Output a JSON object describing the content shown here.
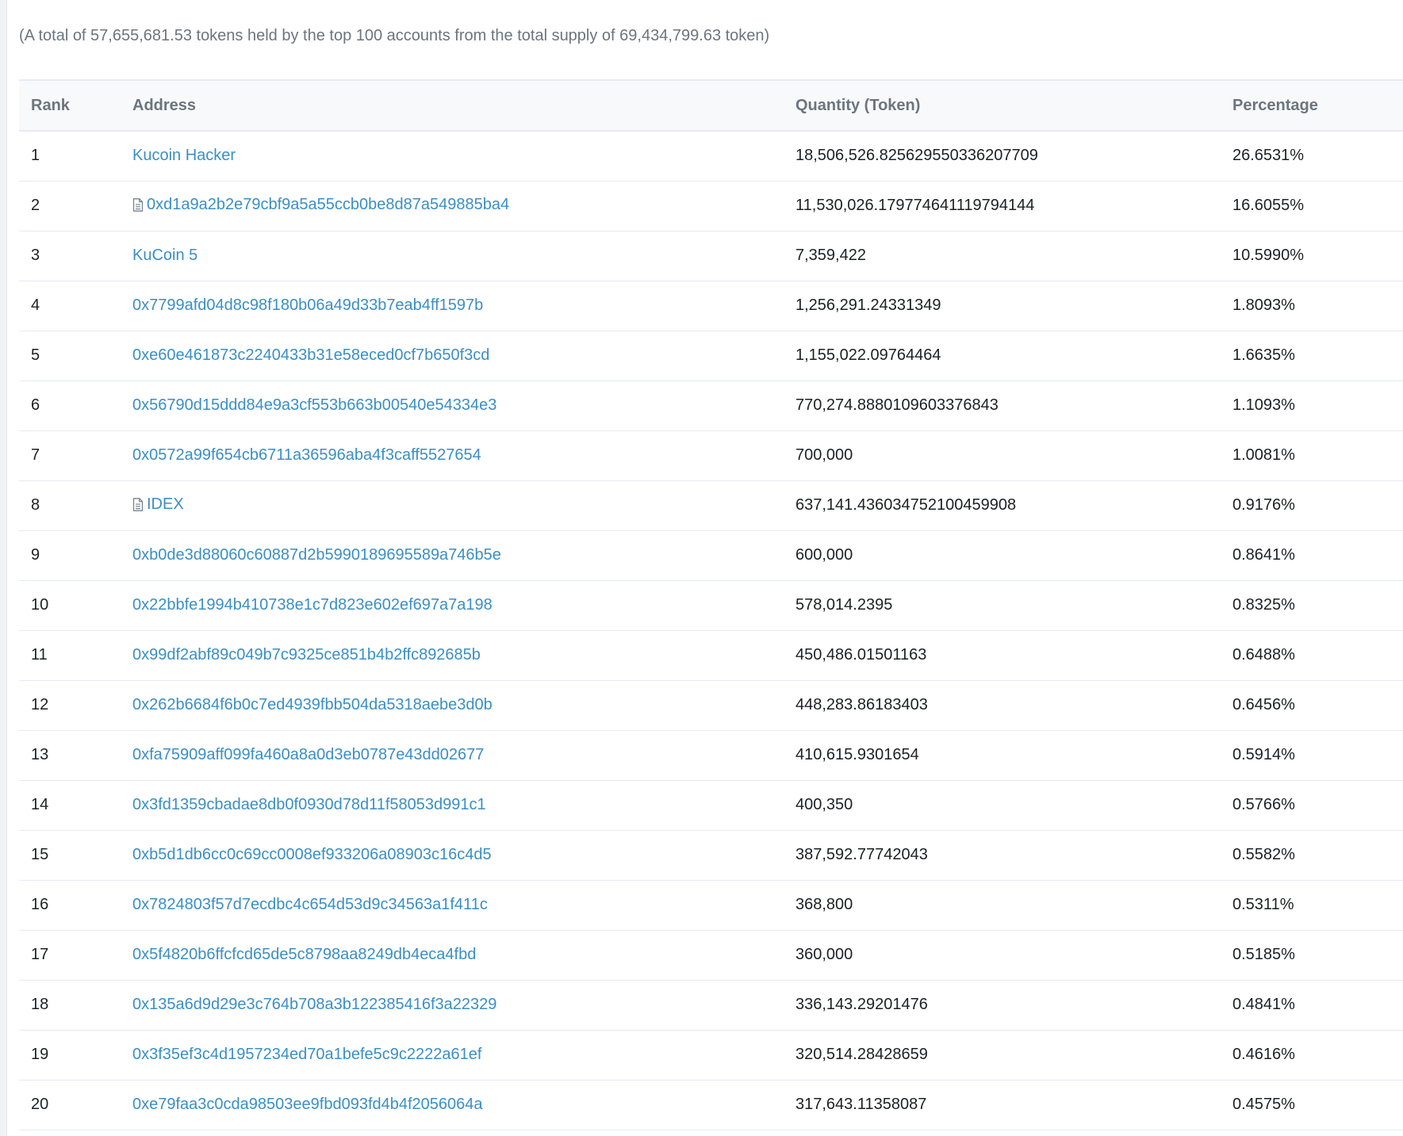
{
  "summary": "(A total of 57,655,681.53 tokens held by the top 100 accounts from the total supply of 69,434,799.63 token)",
  "table": {
    "headers": {
      "rank": "Rank",
      "address": "Address",
      "quantity": "Quantity (Token)",
      "percentage": "Percentage"
    },
    "rows": [
      {
        "rank": "1",
        "address": "Kucoin Hacker",
        "contract_icon": false,
        "quantity": "18,506,526.825629550336207709",
        "percentage": "26.6531%"
      },
      {
        "rank": "2",
        "address": "0xd1a9a2b2e79cbf9a5a55ccb0be8d87a549885ba4",
        "contract_icon": true,
        "quantity": "11,530,026.179774641119794144",
        "percentage": "16.6055%"
      },
      {
        "rank": "3",
        "address": "KuCoin 5",
        "contract_icon": false,
        "quantity": "7,359,422",
        "percentage": "10.5990%"
      },
      {
        "rank": "4",
        "address": "0x7799afd04d8c98f180b06a49d33b7eab4ff1597b",
        "contract_icon": false,
        "quantity": "1,256,291.24331349",
        "percentage": "1.8093%"
      },
      {
        "rank": "5",
        "address": "0xe60e461873c2240433b31e58eced0cf7b650f3cd",
        "contract_icon": false,
        "quantity": "1,155,022.09764464",
        "percentage": "1.6635%"
      },
      {
        "rank": "6",
        "address": "0x56790d15ddd84e9a3cf553b663b00540e54334e3",
        "contract_icon": false,
        "quantity": "770,274.8880109603376843",
        "percentage": "1.1093%"
      },
      {
        "rank": "7",
        "address": "0x0572a99f654cb6711a36596aba4f3caff5527654",
        "contract_icon": false,
        "quantity": "700,000",
        "percentage": "1.0081%"
      },
      {
        "rank": "8",
        "address": "IDEX",
        "contract_icon": true,
        "quantity": "637,141.436034752100459908",
        "percentage": "0.9176%"
      },
      {
        "rank": "9",
        "address": "0xb0de3d88060c60887d2b5990189695589a746b5e",
        "contract_icon": false,
        "quantity": "600,000",
        "percentage": "0.8641%"
      },
      {
        "rank": "10",
        "address": "0x22bbfe1994b410738e1c7d823e602ef697a7a198",
        "contract_icon": false,
        "quantity": "578,014.2395",
        "percentage": "0.8325%"
      },
      {
        "rank": "11",
        "address": "0x99df2abf89c049b7c9325ce851b4b2ffc892685b",
        "contract_icon": false,
        "quantity": "450,486.01501163",
        "percentage": "0.6488%"
      },
      {
        "rank": "12",
        "address": "0x262b6684f6b0c7ed4939fbb504da5318aebe3d0b",
        "contract_icon": false,
        "quantity": "448,283.86183403",
        "percentage": "0.6456%"
      },
      {
        "rank": "13",
        "address": "0xfa75909aff099fa460a8a0d3eb0787e43dd02677",
        "contract_icon": false,
        "quantity": "410,615.9301654",
        "percentage": "0.5914%"
      },
      {
        "rank": "14",
        "address": "0x3fd1359cbadae8db0f0930d78d11f58053d991c1",
        "contract_icon": false,
        "quantity": "400,350",
        "percentage": "0.5766%"
      },
      {
        "rank": "15",
        "address": "0xb5d1db6cc0c69cc0008ef933206a08903c16c4d5",
        "contract_icon": false,
        "quantity": "387,592.77742043",
        "percentage": "0.5582%"
      },
      {
        "rank": "16",
        "address": "0x7824803f57d7ecdbc4c654d53d9c34563a1f411c",
        "contract_icon": false,
        "quantity": "368,800",
        "percentage": "0.5311%"
      },
      {
        "rank": "17",
        "address": "0x5f4820b6ffcfcd65de5c8798aa8249db4eca4fbd",
        "contract_icon": false,
        "quantity": "360,000",
        "percentage": "0.5185%"
      },
      {
        "rank": "18",
        "address": "0x135a6d9d29e3c764b708a3b122385416f3a22329",
        "contract_icon": false,
        "quantity": "336,143.29201476",
        "percentage": "0.4841%"
      },
      {
        "rank": "19",
        "address": "0x3f35ef3c4d1957234ed70a1befe5c9c2222a61ef",
        "contract_icon": false,
        "quantity": "320,514.28428659",
        "percentage": "0.4616%"
      },
      {
        "rank": "20",
        "address": "0xe79faa3c0cda98503ee9fbd093fd4b4f2056064a",
        "contract_icon": false,
        "quantity": "317,643.11358087",
        "percentage": "0.4575%"
      }
    ]
  },
  "colors": {
    "link": "#3a8fc5",
    "muted": "#6c757e",
    "text": "#1e2022",
    "header_bg": "#f8f9fa",
    "border": "#e7eaf3"
  }
}
